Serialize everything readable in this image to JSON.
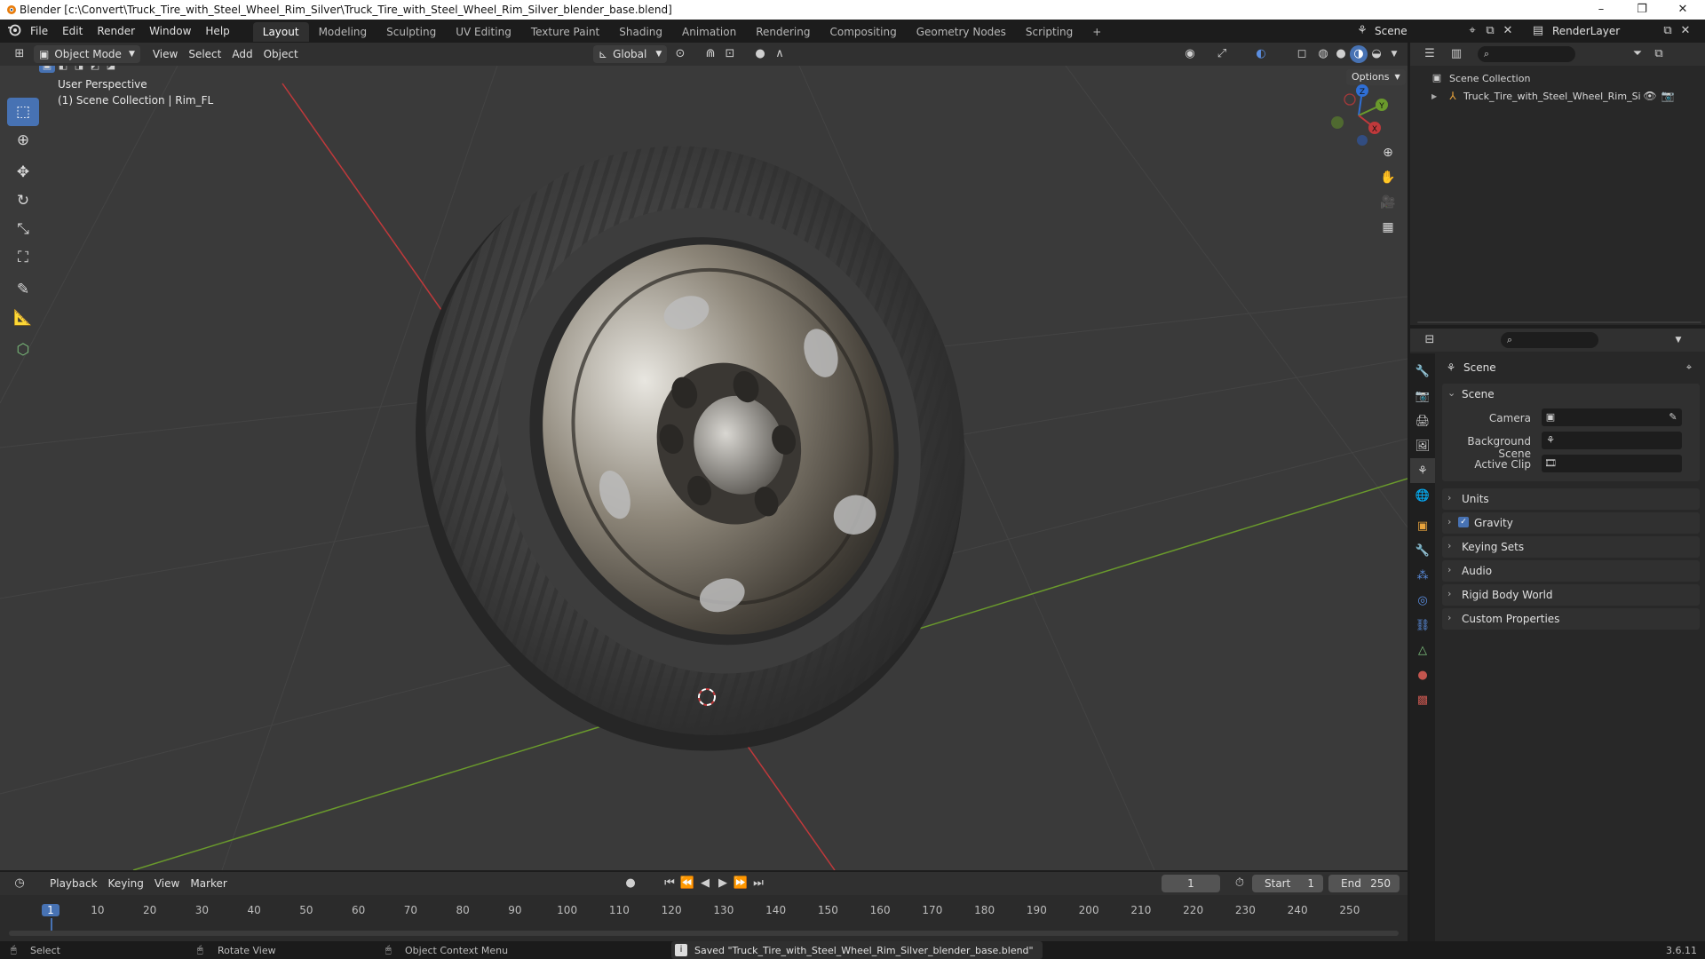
{
  "window": {
    "title": "Blender [c:\\Convert\\Truck_Tire_with_Steel_Wheel_Rim_Silver\\Truck_Tire_with_Steel_Wheel_Rim_Silver_blender_base.blend]",
    "minimize": "–",
    "maximize": "❐",
    "close": "✕"
  },
  "menu": [
    "File",
    "Edit",
    "Render",
    "Window",
    "Help"
  ],
  "workspaces": [
    "Layout",
    "Modeling",
    "Sculpting",
    "UV Editing",
    "Texture Paint",
    "Shading",
    "Animation",
    "Rendering",
    "Compositing",
    "Geometry Nodes",
    "Scripting",
    "+"
  ],
  "active_workspace": "Layout",
  "scene_name": "Scene",
  "view_layer": "RenderLayer",
  "viewport_header": {
    "mode": "Object Mode",
    "menus": [
      "View",
      "Select",
      "Add",
      "Object"
    ],
    "transform_orientation": "Global",
    "options": "Options"
  },
  "viewport": {
    "perspective": "User Perspective",
    "collection_info": "(1) Scene Collection | Rim_FL",
    "gizmo_axes": {
      "x": "X",
      "y": "Y",
      "z": "Z"
    }
  },
  "tools": [
    "select-box",
    "cursor",
    "move",
    "rotate",
    "scale",
    "transform",
    "annotate",
    "measure",
    "add-cube"
  ],
  "outliner": {
    "root": "Scene Collection",
    "items": [
      "Truck_Tire_with_Steel_Wheel_Rim_Silve"
    ]
  },
  "properties": {
    "header": "Scene",
    "section": "Scene",
    "fields": {
      "camera": "Camera",
      "background_scene": "Background Scene",
      "active_clip": "Active Clip"
    },
    "panels": [
      "Units",
      "Gravity",
      "Keying Sets",
      "Audio",
      "Rigid Body World",
      "Custom Properties"
    ]
  },
  "timeline": {
    "menus": [
      "Playback",
      "Keying",
      "View",
      "Marker"
    ],
    "current_frame": "1",
    "start_label": "Start",
    "start": "1",
    "end_label": "End",
    "end": "250",
    "ticks": [
      "1",
      "10",
      "20",
      "30",
      "40",
      "50",
      "60",
      "70",
      "80",
      "90",
      "100",
      "110",
      "120",
      "130",
      "140",
      "150",
      "160",
      "170",
      "180",
      "190",
      "200",
      "210",
      "220",
      "230",
      "240",
      "250"
    ]
  },
  "statusbar": {
    "select": "Select",
    "rotate": "Rotate View",
    "context": "Object Context Menu",
    "message": "Saved \"Truck_Tire_with_Steel_Wheel_Rim_Silver_blender_base.blend\"",
    "version": "3.6.11"
  },
  "colors": {
    "accent": "#4772b3",
    "x_axis": "#c0393b",
    "y_axis": "#6a9a2c",
    "z_axis": "#2f6fd6"
  }
}
